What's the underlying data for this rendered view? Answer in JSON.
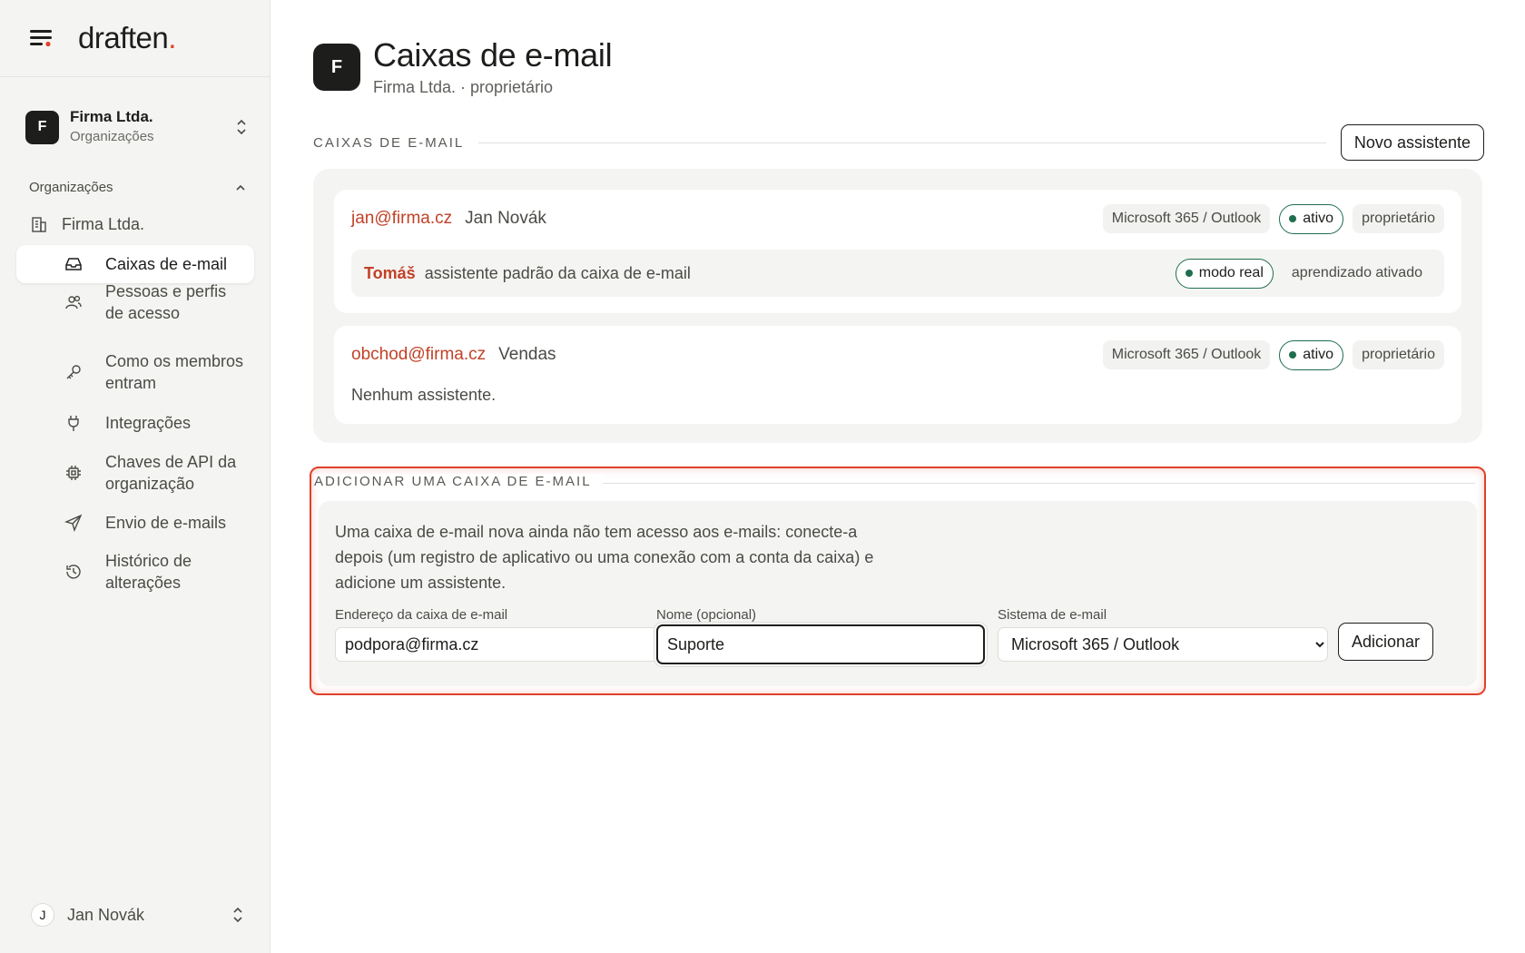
{
  "brand": {
    "name": "draften",
    "dot": "."
  },
  "org_switcher": {
    "initial": "F",
    "name": "Firma Ltda.",
    "subtitle": "Organizações"
  },
  "sidebar": {
    "section_title": "Organizações",
    "org_item": "Firma Ltda.",
    "items": [
      {
        "label": "Caixas de e-mail",
        "icon": "inbox-icon",
        "active": true
      },
      {
        "label": "Pessoas e perfis de acesso",
        "icon": "users-icon"
      },
      {
        "label": "Como os membros entram",
        "icon": "key-icon"
      },
      {
        "label": "Integrações",
        "icon": "plug-icon"
      },
      {
        "label": "Chaves de API da organização",
        "icon": "chip-icon"
      },
      {
        "label": "Envio de e-mails",
        "icon": "send-icon"
      },
      {
        "label": "Histórico de alterações",
        "icon": "history-icon"
      }
    ]
  },
  "user": {
    "initial": "J",
    "name": "Jan Novák"
  },
  "page": {
    "initial": "F",
    "title": "Caixas de e-mail",
    "subtitle": "Firma Ltda. · proprietário"
  },
  "mailboxes_section": {
    "label": "CAIXAS DE E-MAIL",
    "new_assistant": "Novo assistente"
  },
  "mailboxes": [
    {
      "email": "jan@firma.cz",
      "name": "Jan Novák",
      "system": "Microsoft 365 / Outlook",
      "status": "ativo",
      "role": "proprietário",
      "assistant": {
        "name": "Tomáš",
        "description": "assistente padrão da caixa de e-mail",
        "mode": "modo real",
        "learning": "aprendizado ativado"
      }
    },
    {
      "email": "obchod@firma.cz",
      "name": "Vendas",
      "system": "Microsoft 365 / Outlook",
      "status": "ativo",
      "role": "proprietário",
      "no_assistant": "Nenhum assistente."
    }
  ],
  "add_mailbox": {
    "label": "ADICIONAR UMA CAIXA DE E-MAIL",
    "description": "Uma caixa de e-mail nova ainda não tem acesso aos e-mails: conecte-a depois (um registro de aplicativo ou uma conexão com a conta da caixa) e adicione um assistente.",
    "address_label": "Endereço da caixa de e-mail",
    "address_value": "podpora@firma.cz",
    "name_label": "Nome (opcional)",
    "name_value": "Suporte",
    "system_label": "Sistema de e-mail",
    "system_value": "Microsoft 365 / Outlook",
    "add_button": "Adicionar"
  },
  "colors": {
    "accent": "#e0412a",
    "link": "#c24127",
    "success": "#1f6e4e"
  }
}
